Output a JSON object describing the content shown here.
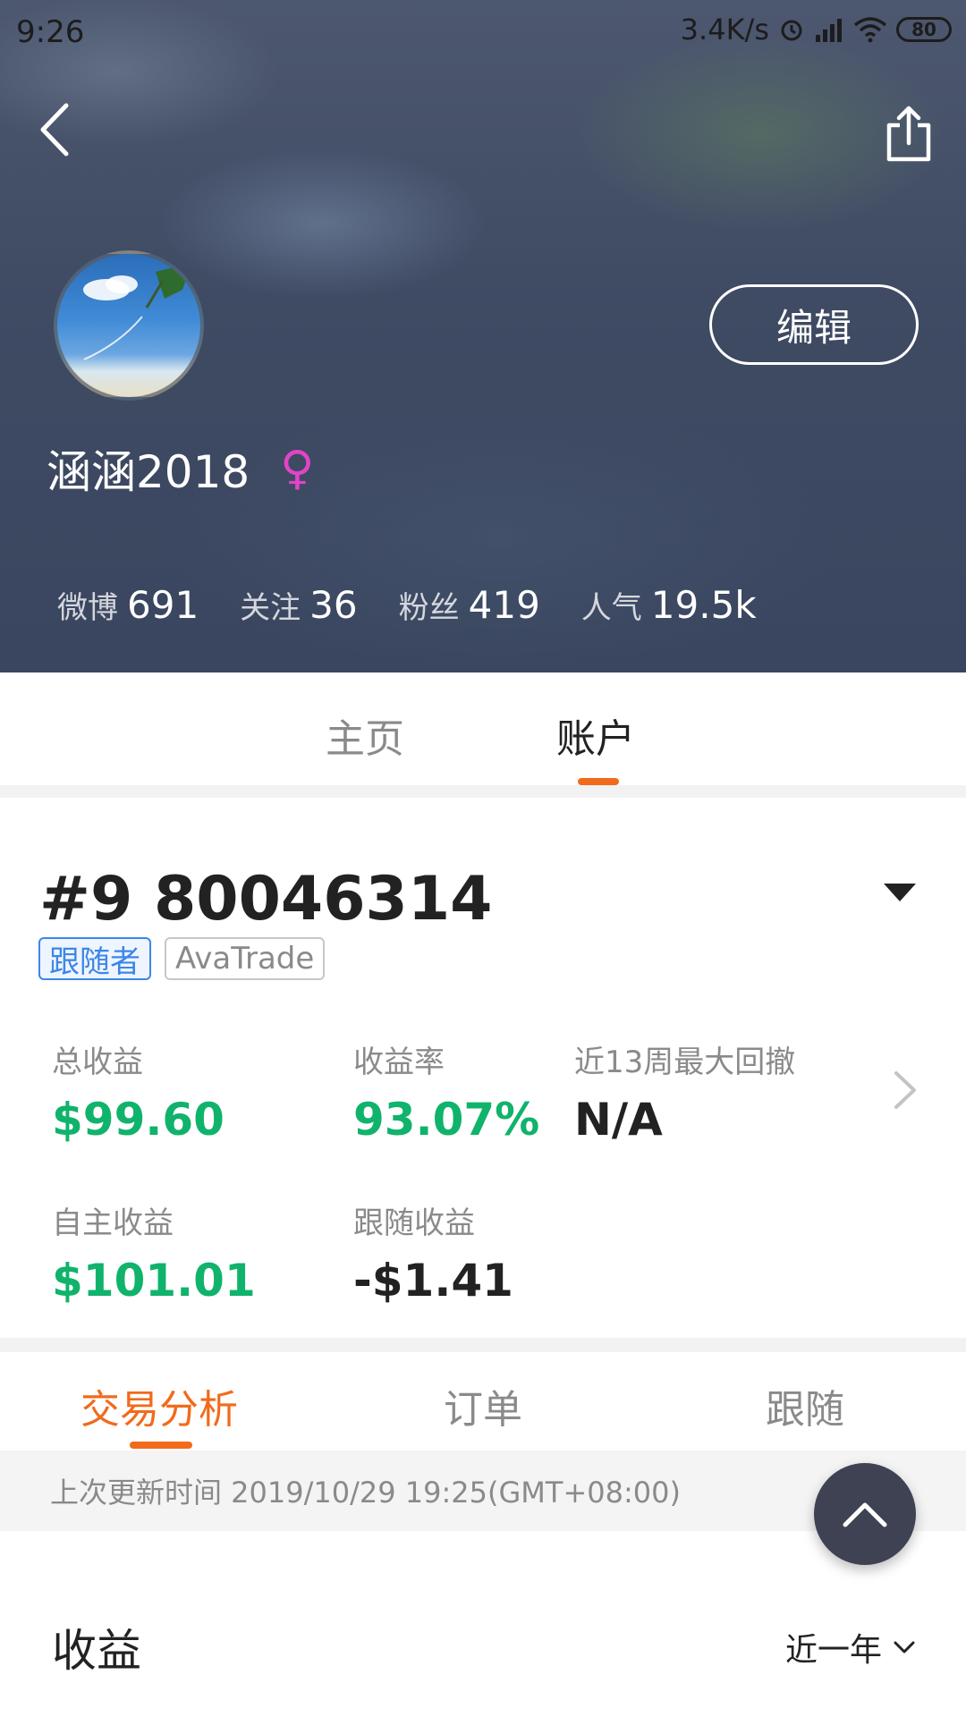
{
  "status_bar": {
    "time": "9:26",
    "net_speed": "3.4K/s",
    "battery": "80",
    "icons": [
      "alarm-icon",
      "signal-icon",
      "wifi-icon",
      "battery-icon"
    ]
  },
  "header": {
    "back_icon": "chevron-left-icon",
    "share_icon": "share-icon",
    "edit_label": "编辑",
    "username": "涵涵2018",
    "gender_symbol": "♀",
    "stats": [
      {
        "label": "微博",
        "value": "691"
      },
      {
        "label": "关注",
        "value": "36"
      },
      {
        "label": "粉丝",
        "value": "419"
      },
      {
        "label": "人气",
        "value": "19.5k"
      }
    ]
  },
  "profile_tabs": {
    "home": "主页",
    "account": "账户",
    "active": "account"
  },
  "account": {
    "id": "#9 80046314",
    "tags": {
      "role": "跟随者",
      "broker": "AvaTrade"
    },
    "metrics": {
      "total_profit": {
        "label": "总收益",
        "value": "$99.60"
      },
      "return_rate": {
        "label": "收益率",
        "value": "93.07%"
      },
      "max_drawdown": {
        "label": "近13周最大回撤",
        "value": "N/A"
      },
      "self_profit": {
        "label": "自主收益",
        "value": "$101.01"
      },
      "follow_profit": {
        "label": "跟随收益",
        "value": "-$1.41"
      }
    }
  },
  "sub_tabs": {
    "analysis": "交易分析",
    "orders": "订单",
    "follow": "跟随",
    "active": "analysis"
  },
  "update_info": "上次更新时间 2019/10/29 19:25(GMT+08:00)",
  "profit_section": {
    "title": "收益",
    "period": "近一年"
  },
  "colors": {
    "accent": "#f26a1b",
    "positive": "#10b36b",
    "tag_blue": "#3d86e8",
    "fab": "#3f4252"
  }
}
